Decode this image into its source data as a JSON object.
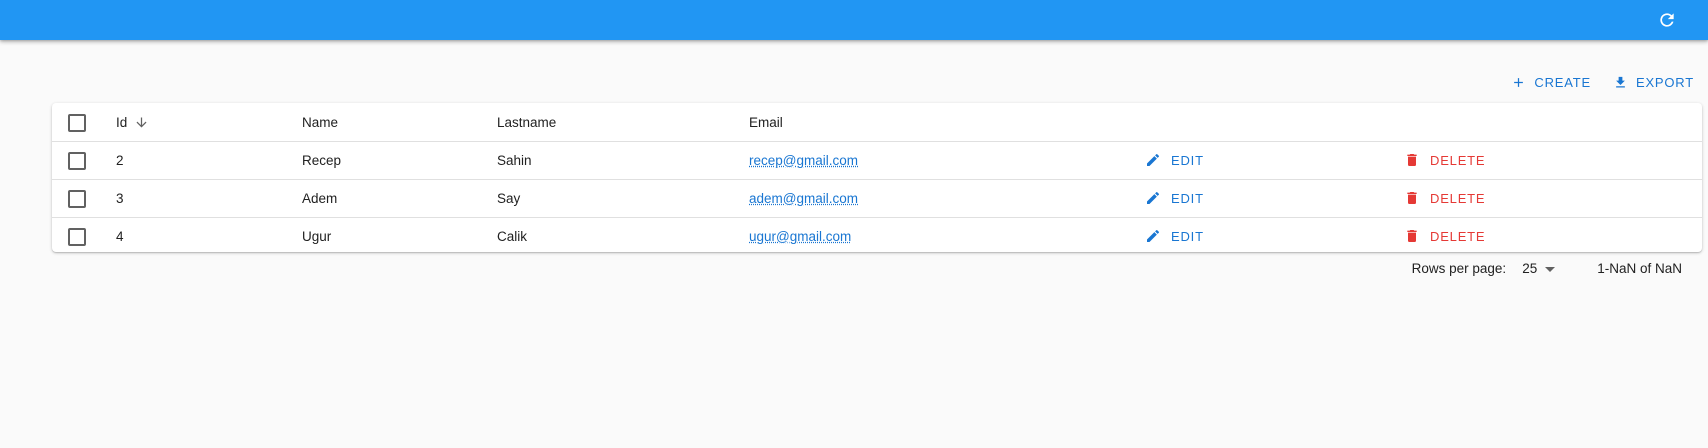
{
  "toolbar": {
    "create_label": "Create",
    "export_label": "Export"
  },
  "table": {
    "columns": {
      "id": "Id",
      "name": "Name",
      "lastname": "Lastname",
      "email": "Email"
    },
    "rows": [
      {
        "id": "2",
        "name": "Recep",
        "lastname": "Sahin",
        "email": "recep@gmail.com"
      },
      {
        "id": "3",
        "name": "Adem",
        "lastname": "Say",
        "email": "adem@gmail.com"
      },
      {
        "id": "4",
        "name": "Ugur",
        "lastname": "Calik",
        "email": "ugur@gmail.com"
      }
    ],
    "edit_label": "Edit",
    "delete_label": "Delete"
  },
  "pagination": {
    "rows_per_page_label": "Rows per page:",
    "rows_per_page_value": "25",
    "range_label": "1-NaN of NaN"
  },
  "icons": {
    "refresh": "refresh-icon",
    "create": "add-icon",
    "export": "download-icon",
    "sort": "arrow-down-icon",
    "edit": "pencil-icon",
    "delete": "trash-icon"
  },
  "colors": {
    "appbar": "#2196f3",
    "primary": "#1976d2",
    "danger": "#e53935"
  }
}
